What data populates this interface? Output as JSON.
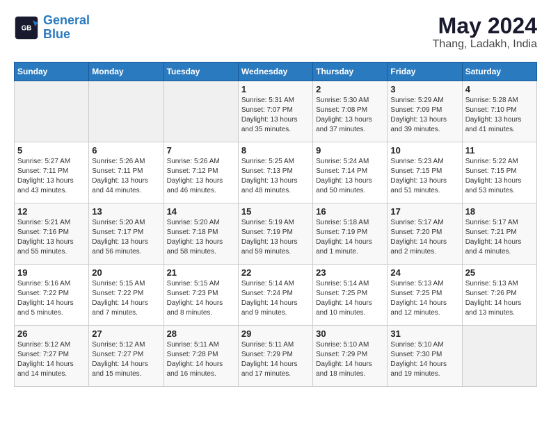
{
  "header": {
    "logo_line1": "General",
    "logo_line2": "Blue",
    "month_year": "May 2024",
    "location": "Thang, Ladakh, India"
  },
  "weekdays": [
    "Sunday",
    "Monday",
    "Tuesday",
    "Wednesday",
    "Thursday",
    "Friday",
    "Saturday"
  ],
  "rows": [
    [
      {
        "day": "",
        "detail": ""
      },
      {
        "day": "",
        "detail": ""
      },
      {
        "day": "",
        "detail": ""
      },
      {
        "day": "1",
        "detail": "Sunrise: 5:31 AM\nSunset: 7:07 PM\nDaylight: 13 hours\nand 35 minutes."
      },
      {
        "day": "2",
        "detail": "Sunrise: 5:30 AM\nSunset: 7:08 PM\nDaylight: 13 hours\nand 37 minutes."
      },
      {
        "day": "3",
        "detail": "Sunrise: 5:29 AM\nSunset: 7:09 PM\nDaylight: 13 hours\nand 39 minutes."
      },
      {
        "day": "4",
        "detail": "Sunrise: 5:28 AM\nSunset: 7:10 PM\nDaylight: 13 hours\nand 41 minutes."
      }
    ],
    [
      {
        "day": "5",
        "detail": "Sunrise: 5:27 AM\nSunset: 7:11 PM\nDaylight: 13 hours\nand 43 minutes."
      },
      {
        "day": "6",
        "detail": "Sunrise: 5:26 AM\nSunset: 7:11 PM\nDaylight: 13 hours\nand 44 minutes."
      },
      {
        "day": "7",
        "detail": "Sunrise: 5:26 AM\nSunset: 7:12 PM\nDaylight: 13 hours\nand 46 minutes."
      },
      {
        "day": "8",
        "detail": "Sunrise: 5:25 AM\nSunset: 7:13 PM\nDaylight: 13 hours\nand 48 minutes."
      },
      {
        "day": "9",
        "detail": "Sunrise: 5:24 AM\nSunset: 7:14 PM\nDaylight: 13 hours\nand 50 minutes."
      },
      {
        "day": "10",
        "detail": "Sunrise: 5:23 AM\nSunset: 7:15 PM\nDaylight: 13 hours\nand 51 minutes."
      },
      {
        "day": "11",
        "detail": "Sunrise: 5:22 AM\nSunset: 7:15 PM\nDaylight: 13 hours\nand 53 minutes."
      }
    ],
    [
      {
        "day": "12",
        "detail": "Sunrise: 5:21 AM\nSunset: 7:16 PM\nDaylight: 13 hours\nand 55 minutes."
      },
      {
        "day": "13",
        "detail": "Sunrise: 5:20 AM\nSunset: 7:17 PM\nDaylight: 13 hours\nand 56 minutes."
      },
      {
        "day": "14",
        "detail": "Sunrise: 5:20 AM\nSunset: 7:18 PM\nDaylight: 13 hours\nand 58 minutes."
      },
      {
        "day": "15",
        "detail": "Sunrise: 5:19 AM\nSunset: 7:19 PM\nDaylight: 13 hours\nand 59 minutes."
      },
      {
        "day": "16",
        "detail": "Sunrise: 5:18 AM\nSunset: 7:19 PM\nDaylight: 14 hours\nand 1 minute."
      },
      {
        "day": "17",
        "detail": "Sunrise: 5:17 AM\nSunset: 7:20 PM\nDaylight: 14 hours\nand 2 minutes."
      },
      {
        "day": "18",
        "detail": "Sunrise: 5:17 AM\nSunset: 7:21 PM\nDaylight: 14 hours\nand 4 minutes."
      }
    ],
    [
      {
        "day": "19",
        "detail": "Sunrise: 5:16 AM\nSunset: 7:22 PM\nDaylight: 14 hours\nand 5 minutes."
      },
      {
        "day": "20",
        "detail": "Sunrise: 5:15 AM\nSunset: 7:22 PM\nDaylight: 14 hours\nand 7 minutes."
      },
      {
        "day": "21",
        "detail": "Sunrise: 5:15 AM\nSunset: 7:23 PM\nDaylight: 14 hours\nand 8 minutes."
      },
      {
        "day": "22",
        "detail": "Sunrise: 5:14 AM\nSunset: 7:24 PM\nDaylight: 14 hours\nand 9 minutes."
      },
      {
        "day": "23",
        "detail": "Sunrise: 5:14 AM\nSunset: 7:25 PM\nDaylight: 14 hours\nand 10 minutes."
      },
      {
        "day": "24",
        "detail": "Sunrise: 5:13 AM\nSunset: 7:25 PM\nDaylight: 14 hours\nand 12 minutes."
      },
      {
        "day": "25",
        "detail": "Sunrise: 5:13 AM\nSunset: 7:26 PM\nDaylight: 14 hours\nand 13 minutes."
      }
    ],
    [
      {
        "day": "26",
        "detail": "Sunrise: 5:12 AM\nSunset: 7:27 PM\nDaylight: 14 hours\nand 14 minutes."
      },
      {
        "day": "27",
        "detail": "Sunrise: 5:12 AM\nSunset: 7:27 PM\nDaylight: 14 hours\nand 15 minutes."
      },
      {
        "day": "28",
        "detail": "Sunrise: 5:11 AM\nSunset: 7:28 PM\nDaylight: 14 hours\nand 16 minutes."
      },
      {
        "day": "29",
        "detail": "Sunrise: 5:11 AM\nSunset: 7:29 PM\nDaylight: 14 hours\nand 17 minutes."
      },
      {
        "day": "30",
        "detail": "Sunrise: 5:10 AM\nSunset: 7:29 PM\nDaylight: 14 hours\nand 18 minutes."
      },
      {
        "day": "31",
        "detail": "Sunrise: 5:10 AM\nSunset: 7:30 PM\nDaylight: 14 hours\nand 19 minutes."
      },
      {
        "day": "",
        "detail": ""
      }
    ]
  ]
}
